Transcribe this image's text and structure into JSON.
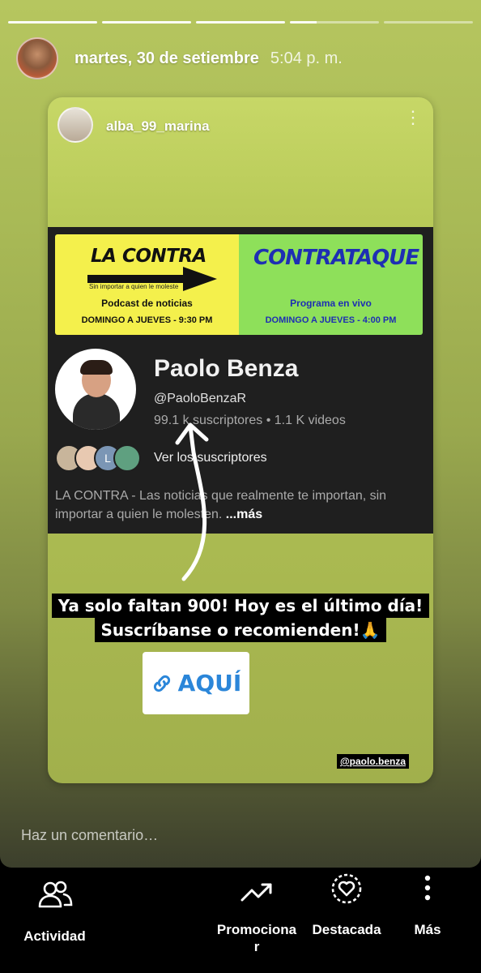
{
  "story": {
    "progress_segments": 5,
    "date": "martes, 30 de setiembre",
    "time": "5:04 p. m.",
    "comment_placeholder": "Haz un comentario…"
  },
  "reshared_post": {
    "username": "alba_99_marina",
    "mention": "@paolo.benza"
  },
  "youtube_card": {
    "banner_left_title": "LA CONTRA",
    "banner_left_subtitle": "Sin importar a quien le moleste",
    "banner_left_line1": "Podcast de noticias",
    "banner_left_line2": "DOMINGO A JUEVES - 9:30 PM",
    "banner_right_title": "CONTRATAQUE",
    "banner_right_line1": "Programa en vivo",
    "banner_right_line2": "DOMINGO A JUEVES - 4:00 PM",
    "channel_name": "Paolo Benza",
    "handle": "@PaoloBenzaR",
    "stats": "99.1 k suscriptores • 1.1 K videos",
    "see_subscribers": "Ver los suscriptores",
    "subscriber_avatar_letter": "L",
    "description": "LA CONTRA - Las noticias que realmente te importan, sin importar a quien le molesten.",
    "more": "...más"
  },
  "caption": {
    "line1": "Ya solo faltan 900! Hoy es el último día!",
    "line2": "Suscríbanse o recomienden!🙏"
  },
  "link_sticker": {
    "label": "AQUÍ"
  },
  "bottom_bar": {
    "actividad": "Actividad",
    "promocionar_1": "Promociona",
    "promocionar_2": "r",
    "destacada": "Destacada",
    "mas": "Más"
  },
  "colors": {
    "accent_link": "#2b86d9",
    "banner_yellow": "#f4f04c",
    "banner_green": "#8ee05a",
    "banner_blue": "#1e2fb3"
  }
}
